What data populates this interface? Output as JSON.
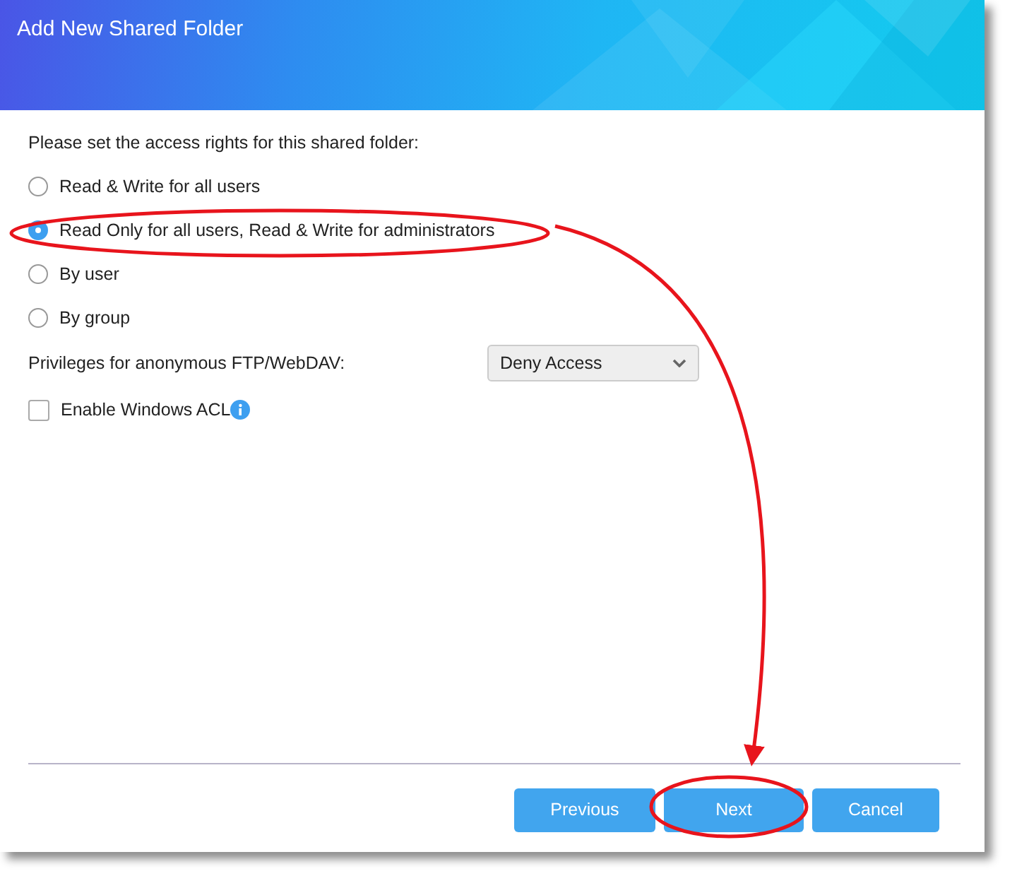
{
  "window": {
    "title": "Add New Shared Folder"
  },
  "prompt": "Please set the access rights for this shared folder:",
  "access_options": [
    {
      "label": "Read & Write for all users",
      "selected": false
    },
    {
      "label": "Read Only for all users, Read & Write for administrators",
      "selected": true
    },
    {
      "label": "By user",
      "selected": false
    },
    {
      "label": "By group",
      "selected": false
    }
  ],
  "ftp_privileges": {
    "label": "Privileges for anonymous FTP/WebDAV:",
    "value": "Deny Access"
  },
  "windows_acl": {
    "label": "Enable Windows ACL",
    "checked": false
  },
  "buttons": [
    {
      "label": "Previous"
    },
    {
      "label": "Next"
    },
    {
      "label": "Cancel"
    }
  ]
}
